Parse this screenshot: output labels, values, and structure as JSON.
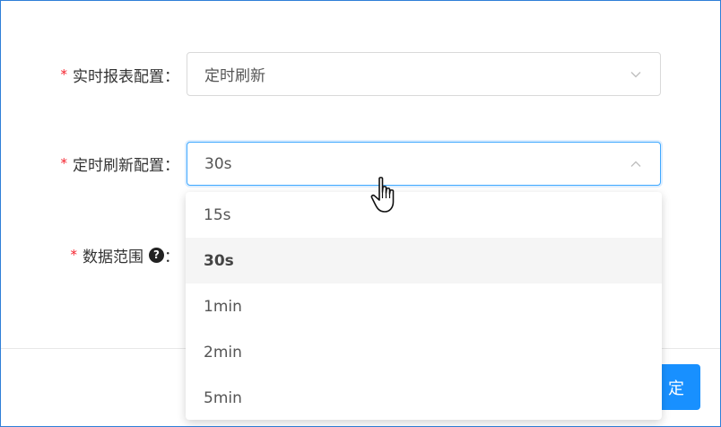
{
  "form": {
    "realtime_report": {
      "required_mark": "*",
      "label": "实时报表配置：",
      "value": "定时刷新"
    },
    "refresh_interval": {
      "required_mark": "*",
      "label": "定时刷新配置：",
      "value": "30s"
    },
    "data_range": {
      "required_mark": "*",
      "label": "数据范围",
      "help_glyph": "?",
      "colon": "："
    }
  },
  "dropdown": {
    "options": [
      "15s",
      "30s",
      "1min",
      "2min",
      "5min"
    ],
    "selected": "30s"
  },
  "footer": {
    "ok_label": "定"
  },
  "colors": {
    "accent": "#1890ff",
    "focus_border": "#40a9ff",
    "required": "#f5222d",
    "selected_option_bg": "#f5f5f5"
  },
  "icons": [
    "chevron-down-icon",
    "chevron-up-icon",
    "question-circle-icon",
    "hand-pointer-cursor"
  ]
}
